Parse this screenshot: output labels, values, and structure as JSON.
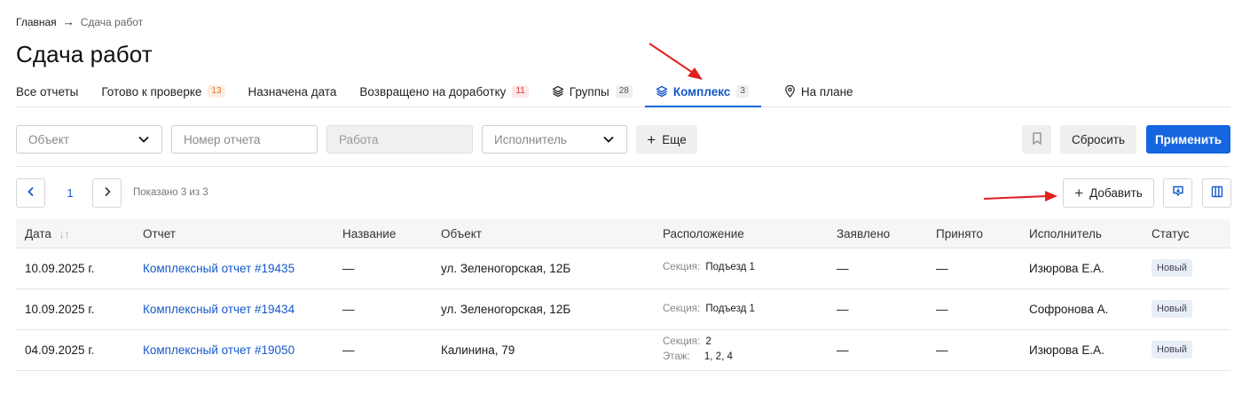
{
  "breadcrumb": {
    "home": "Главная",
    "current": "Сдача работ"
  },
  "page_title": "Сдача работ",
  "tabs": [
    {
      "label": "Все отчеты",
      "badge": ""
    },
    {
      "label": "Готово к проверке",
      "badge": "13"
    },
    {
      "label": "Назначена дата",
      "badge": ""
    },
    {
      "label": "Возвращено на доработку",
      "badge": "11"
    },
    {
      "label": "Группы",
      "badge": "28"
    },
    {
      "label": "Комплекс",
      "badge": "3"
    },
    {
      "label": "На плане",
      "badge": ""
    }
  ],
  "filters": {
    "object_placeholder": "Объект",
    "report_number_placeholder": "Номер отчета",
    "work_placeholder": "Работа",
    "executor_placeholder": "Исполнитель",
    "more_label": "Еще",
    "reset_label": "Сбросить",
    "apply_label": "Применить"
  },
  "pagination": {
    "page": "1",
    "shown": "Показано 3 из 3"
  },
  "toolbar": {
    "add_label": "Добавить"
  },
  "table": {
    "columns": [
      "Дата",
      "Отчет",
      "Название",
      "Объект",
      "Расположение",
      "Заявлено",
      "Принято",
      "Исполнитель",
      "Статус"
    ],
    "rows": [
      {
        "date": "10.09.2025 г.",
        "report": "Комплексный отчет #19435",
        "name": "—",
        "object": "ул. Зеленогорская, 12Б",
        "location": [
          {
            "key": "Секция:",
            "value": "Подъезд 1"
          }
        ],
        "declared": "—",
        "accepted": "—",
        "executor": "Изюрова Е.А.",
        "status": "Новый"
      },
      {
        "date": "10.09.2025 г.",
        "report": "Комплексный отчет #19434",
        "name": "—",
        "object": "ул. Зеленогорская, 12Б",
        "location": [
          {
            "key": "Секция:",
            "value": "Подъезд 1"
          }
        ],
        "declared": "—",
        "accepted": "—",
        "executor": "Софронова А.",
        "status": "Новый"
      },
      {
        "date": "04.09.2025 г.",
        "report": "Комплексный отчет #19050",
        "name": "—",
        "object": "Калинина, 79",
        "location": [
          {
            "key": "Секция:",
            "value": "2"
          },
          {
            "key": "Этаж:",
            "value": "1, 2, 4"
          }
        ],
        "declared": "—",
        "accepted": "—",
        "executor": "Изюрова Е.А.",
        "status": "Новый"
      }
    ]
  },
  "colors": {
    "accent": "#1566e0",
    "link": "#1558c9",
    "annotation": "#e02020"
  }
}
